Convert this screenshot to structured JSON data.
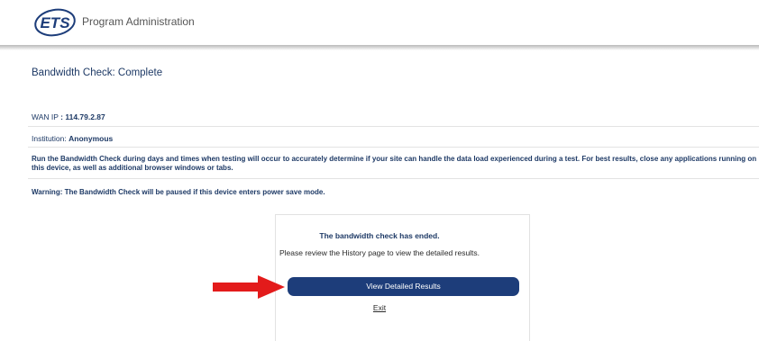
{
  "header": {
    "logo_text": "ETS",
    "title": "Program Administration"
  },
  "page": {
    "title": "Bandwidth Check: Complete"
  },
  "info": {
    "wan_label": "WAN IP",
    "wan_value": ": 114.79.2.87",
    "institution_label": "Institution:",
    "institution_value": "Anonymous"
  },
  "messages": {
    "instructions": "Run the Bandwidth Check during days and times when testing will occur to accurately determine if your site can handle the data load experienced during a test. For best results, close any applications running on this device, as well as additional browser windows or tabs.",
    "warning": "Warning: The Bandwidth Check will be paused if this device enters power save mode."
  },
  "result_panel": {
    "title": "The bandwidth check has ended.",
    "subtitle": "Please review the History page to view the detailed results.",
    "button_label": "View Detailed Results",
    "exit_label": "Exit"
  },
  "colors": {
    "brand_navy": "#1d3d7a",
    "text_navy": "#1e3a66",
    "arrow_red": "#e31b1b"
  }
}
